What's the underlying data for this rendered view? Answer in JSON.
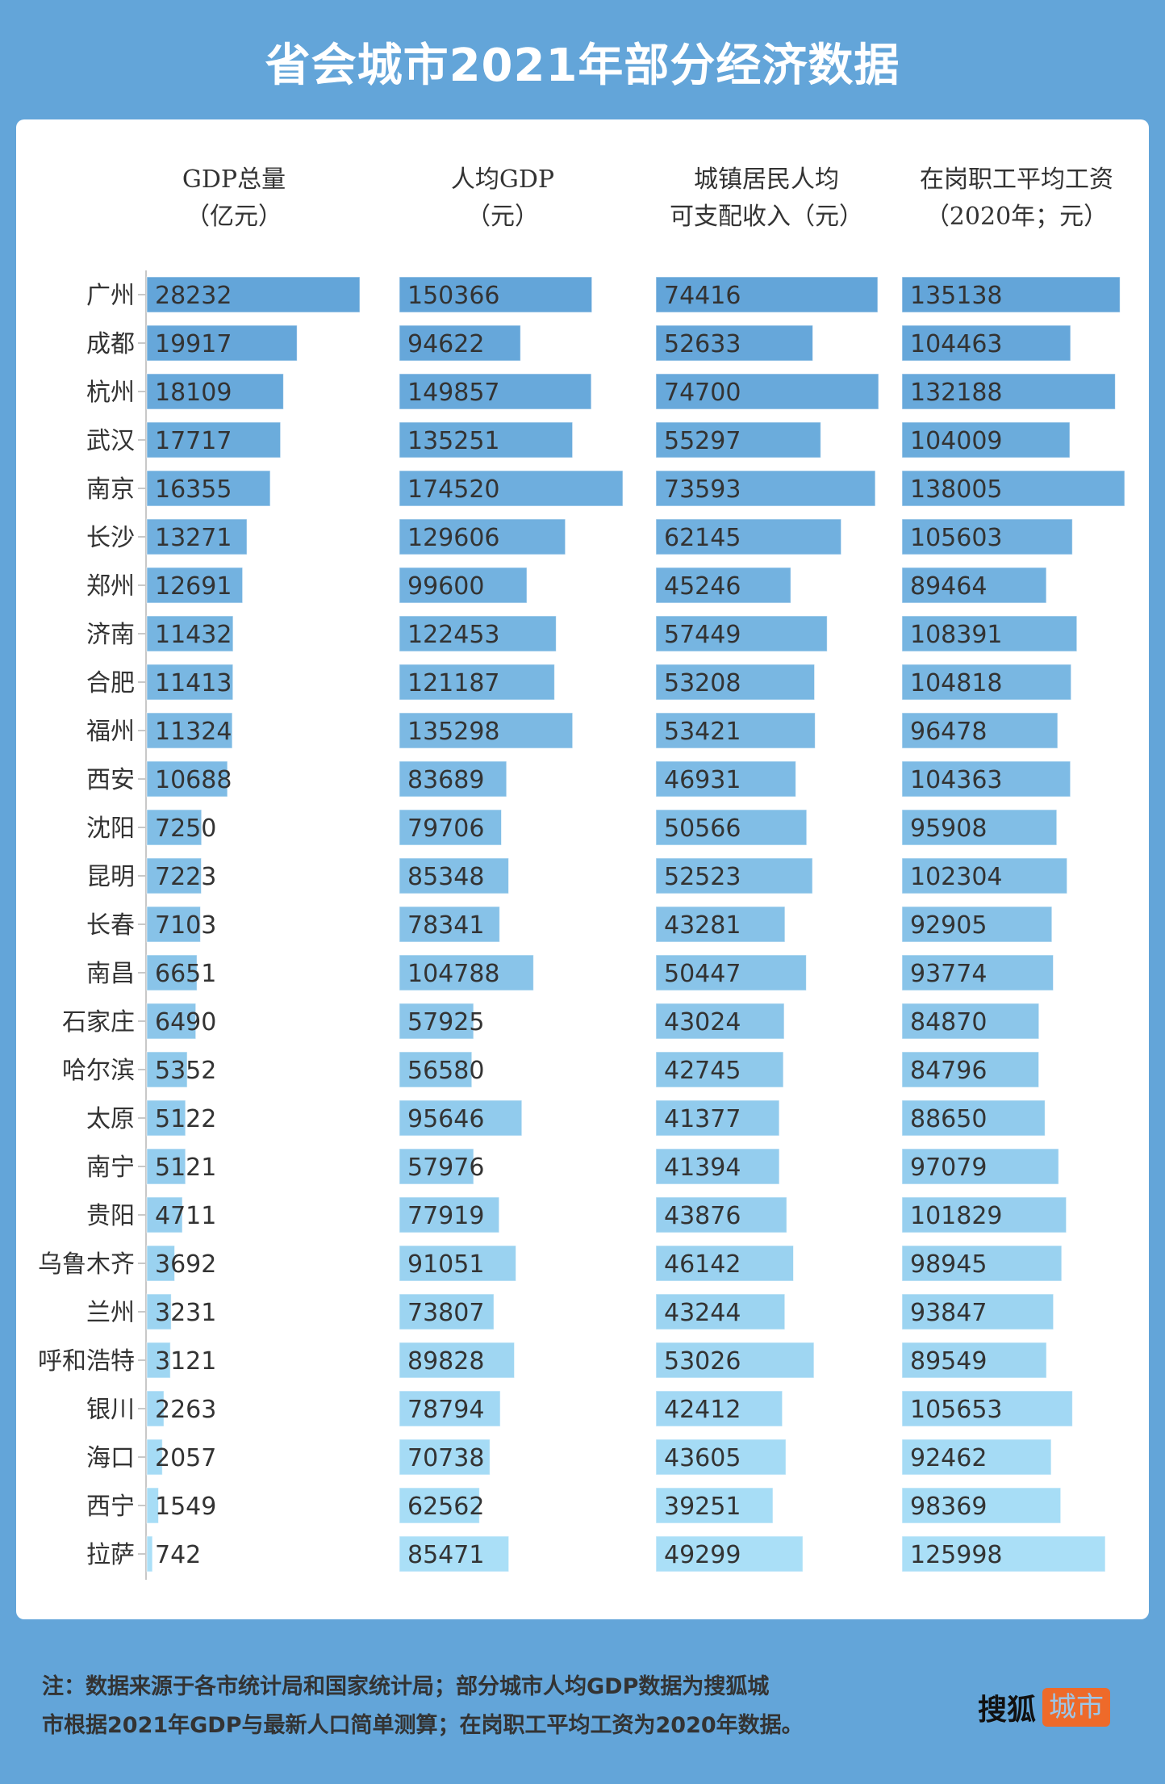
{
  "header": {
    "title": "省会城市2021年部分经济数据"
  },
  "columns": [
    {
      "line1": "GDP总量",
      "line2": "（亿元）"
    },
    {
      "line1": "人均GDP",
      "line2": "（元）"
    },
    {
      "line1": "城镇居民人均",
      "line2": "可支配收入（元）"
    },
    {
      "line1": "在岗职工平均工资",
      "line2": "（2020年；元）"
    }
  ],
  "colors": {
    "bar_top": "#63a5d9",
    "bar_bottom": "#aadff7",
    "background": "#63a5d9",
    "logo_badge": "#ee6a2a"
  },
  "chart_data": {
    "type": "bar",
    "orientation": "horizontal",
    "title": "省会城市2021年部分经济数据",
    "categories": [
      "广州",
      "成都",
      "杭州",
      "武汉",
      "南京",
      "长沙",
      "郑州",
      "济南",
      "合肥",
      "福州",
      "西安",
      "沈阳",
      "昆明",
      "长春",
      "南昌",
      "石家庄",
      "哈尔滨",
      "太原",
      "南宁",
      "贵阳",
      "乌鲁木齐",
      "兰州",
      "呼和浩特",
      "银川",
      "海口",
      "西宁",
      "拉萨"
    ],
    "series": [
      {
        "name": "GDP总量（亿元）",
        "values": [
          28232,
          19917,
          18109,
          17717,
          16355,
          13271,
          12691,
          11432,
          11413,
          11324,
          10688,
          7250,
          7223,
          7103,
          6651,
          6490,
          5352,
          5122,
          5121,
          4711,
          3692,
          3231,
          3121,
          2263,
          2057,
          1549,
          742
        ]
      },
      {
        "name": "人均GDP（元）",
        "values": [
          150366,
          94622,
          149857,
          135251,
          174520,
          129606,
          99600,
          122453,
          121187,
          135298,
          83689,
          79706,
          85348,
          78341,
          104788,
          57925,
          56580,
          95646,
          57976,
          77919,
          91051,
          73807,
          89828,
          78794,
          70738,
          62562,
          85471
        ]
      },
      {
        "name": "城镇居民人均可支配收入（元）",
        "values": [
          74416,
          52633,
          74700,
          55297,
          73593,
          62145,
          45246,
          57449,
          53208,
          53421,
          46931,
          50566,
          52523,
          43281,
          50447,
          43024,
          42745,
          41377,
          41394,
          43876,
          46142,
          43244,
          53026,
          42412,
          43605,
          39251,
          49299
        ]
      },
      {
        "name": "在岗职工平均工资（2020年；元）",
        "values": [
          135138,
          104463,
          132188,
          104009,
          138005,
          105603,
          89464,
          108391,
          104818,
          96478,
          104363,
          95908,
          102304,
          92905,
          93774,
          84870,
          84796,
          88650,
          97079,
          101829,
          98945,
          93847,
          89549,
          105653,
          92462,
          98369,
          125998
        ]
      }
    ],
    "xlabel": "",
    "ylabel": "",
    "grid": false,
    "data_labels": true
  },
  "footer": {
    "note_line1": "注：数据来源于各市统计局和国家统计局；部分城市人均GDP数据为搜狐城",
    "note_line2": "市根据2021年GDP与最新人口简单测算；在岗职工平均工资为2020年数据。",
    "logo_text": "搜狐",
    "logo_badge": "城市"
  }
}
